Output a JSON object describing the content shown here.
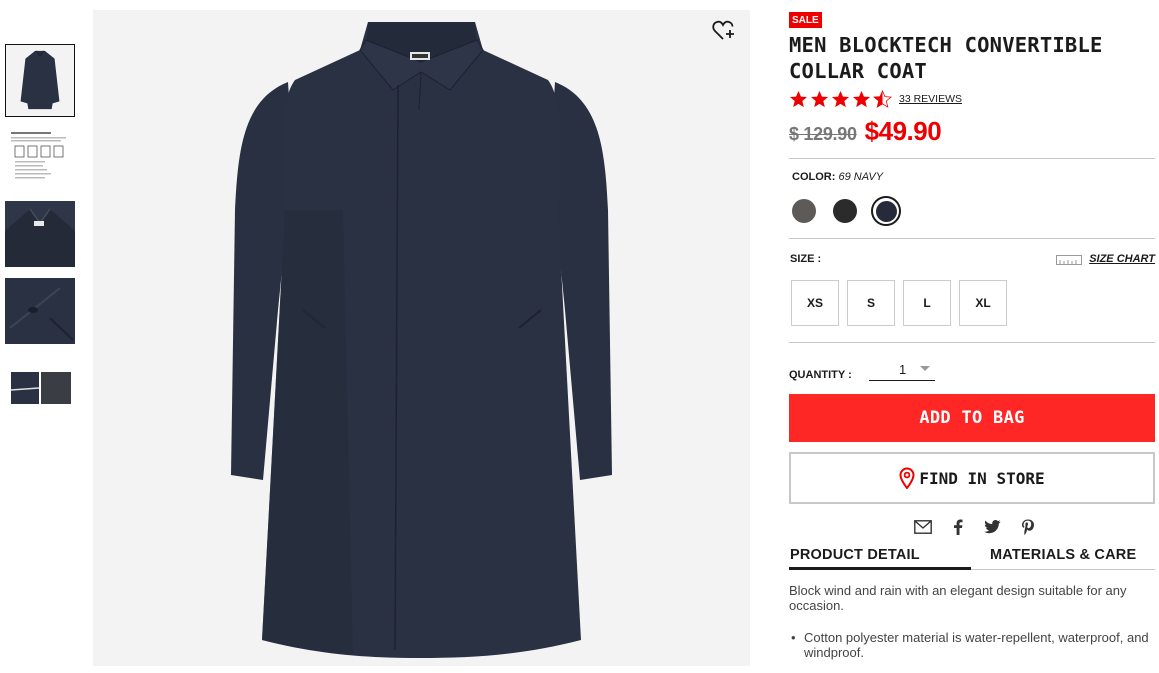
{
  "product": {
    "sale_badge": "SALE",
    "title": "MEN BLOCKTECH CONVERTIBLE COLLAR COAT",
    "rating_stars": 4.5,
    "reviews_label": "33 REVIEWS",
    "price_original": "$ 129.90",
    "price_sale": "$49.90"
  },
  "color": {
    "label": "COLOR:",
    "value": "69 NAVY",
    "swatches": [
      {
        "name": "gray",
        "hex": "#5d5a58"
      },
      {
        "name": "black",
        "hex": "#2b2b2b"
      },
      {
        "name": "navy",
        "hex": "#262a3a",
        "selected": true
      }
    ]
  },
  "size": {
    "label": "SIZE :",
    "chart_label": "SIZE CHART",
    "options": [
      "XS",
      "S",
      "L",
      "XL"
    ]
  },
  "quantity": {
    "label": "QUANTITY :",
    "value": "1"
  },
  "buttons": {
    "add_to_bag": "ADD TO BAG",
    "find_in_store": "FIND IN STORE"
  },
  "share_icons": [
    "mail-icon",
    "facebook-icon",
    "twitter-icon",
    "pinterest-icon"
  ],
  "tabs": {
    "product_detail": "PRODUCT DETAIL",
    "materials_care": "MATERIALS & CARE"
  },
  "detail": {
    "description": "Block wind and rain with an elegant design suitable for any occasion.",
    "bullet_1": "Cotton polyester material is water-repellent, waterproof, and windproof."
  },
  "colors": {
    "accent_red": "#ff2626",
    "sale_red": "#e00000",
    "coat_navy": "#2a3142",
    "image_bg": "#f3f3f3"
  }
}
